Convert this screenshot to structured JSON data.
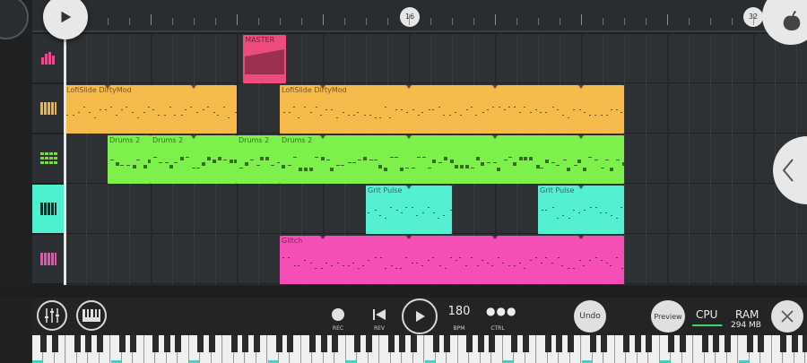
{
  "ruler": {
    "markers": [
      "16",
      "32"
    ]
  },
  "tracks": [
    {
      "icon": "bars-icon",
      "color": "#e44d8f"
    },
    {
      "icon": "piano-icon",
      "color": "#f2b33c"
    },
    {
      "icon": "grid-icon",
      "color": "#7cd83b"
    },
    {
      "icon": "piano-icon",
      "color": "#222222",
      "active": true
    },
    {
      "icon": "piano-icon",
      "color": "#f04db0"
    }
  ],
  "patterns": [
    {
      "label": "MASTER",
      "lane": 0,
      "start": 8.3,
      "length": 2,
      "color": "#ee4c7c"
    },
    {
      "label": "LofiSlide DirtyMod",
      "lane": 1,
      "start": 0,
      "length": 8,
      "color": "#f5b94c"
    },
    {
      "label": "LofiSlide DirtyMod",
      "lane": 1,
      "start": 10,
      "length": 16,
      "color": "#f5b94c"
    },
    {
      "label": "Drums 2",
      "lane": 2,
      "start": 2,
      "length": 2,
      "color": "#7ef04c"
    },
    {
      "label": "Drums 2",
      "lane": 2,
      "start": 4,
      "length": 4,
      "color": "#7ef04c"
    },
    {
      "label": "Drums 2",
      "lane": 2,
      "start": 8,
      "length": 2,
      "color": "#7ef04c"
    },
    {
      "label": "Drums 2",
      "lane": 2,
      "start": 10,
      "length": 16,
      "color": "#7ef04c"
    },
    {
      "label": "Grit Pulse",
      "lane": 3,
      "start": 14,
      "length": 4,
      "color": "#54f0d2"
    },
    {
      "label": "Grit Pulse",
      "lane": 3,
      "start": 22,
      "length": 4,
      "color": "#54f0d2"
    },
    {
      "label": "Glitch",
      "lane": 4,
      "start": 10,
      "length": 16,
      "color": "#f54fb5"
    }
  ],
  "toolbar": {
    "rec_label": "REC",
    "rev_label": "REV",
    "tempo_value": "180",
    "tempo_label": "BPM",
    "ctrl_label": "CTRL",
    "undo_label": "Undo",
    "preview_label": "Preview",
    "cpu_label": "CPU",
    "ram_label": "RAM",
    "ram_value": "294 MB",
    "cpu_load": 0.08
  },
  "colors": {
    "accent_teal": "#4ef0d0",
    "cpu_meter": "#3fd46a"
  }
}
